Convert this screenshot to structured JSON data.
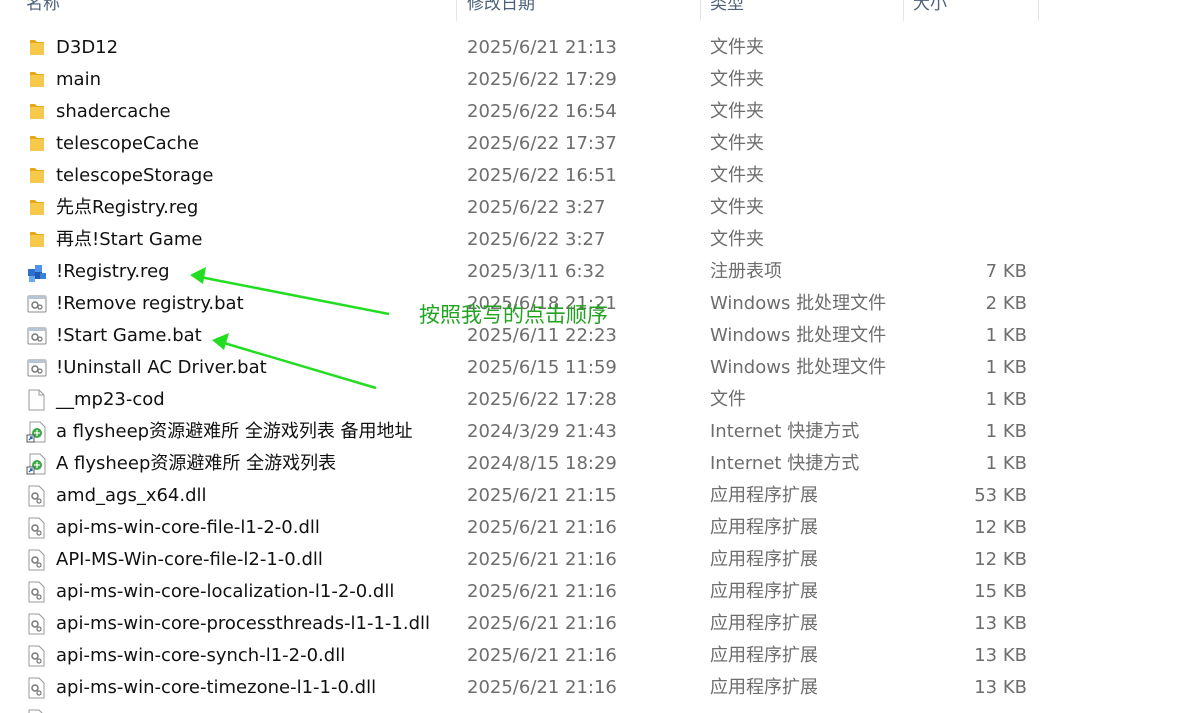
{
  "colors": {
    "annotation": "#22a322",
    "arrow": "#22dd22",
    "folder": "#f5c342",
    "header_text": "#4c607a",
    "secondary_text": "#6d6d6d"
  },
  "header": {
    "name": "名称",
    "date": "修改日期",
    "type": "类型",
    "size": "大小"
  },
  "files": [
    {
      "icon": "folder-icon",
      "name": "D3D12",
      "date": "2025/6/21 21:13",
      "type": "文件夹",
      "size": ""
    },
    {
      "icon": "folder-icon",
      "name": "main",
      "date": "2025/6/22 17:29",
      "type": "文件夹",
      "size": ""
    },
    {
      "icon": "folder-icon",
      "name": "shadercache",
      "date": "2025/6/22 16:54",
      "type": "文件夹",
      "size": ""
    },
    {
      "icon": "folder-icon",
      "name": "telescopeCache",
      "date": "2025/6/22 17:37",
      "type": "文件夹",
      "size": ""
    },
    {
      "icon": "folder-icon",
      "name": "telescopeStorage",
      "date": "2025/6/22 16:51",
      "type": "文件夹",
      "size": ""
    },
    {
      "icon": "folder-icon",
      "name": "先点Registry.reg",
      "date": "2025/6/22 3:27",
      "type": "文件夹",
      "size": ""
    },
    {
      "icon": "folder-icon",
      "name": "再点!Start Game",
      "date": "2025/6/22 3:27",
      "type": "文件夹",
      "size": ""
    },
    {
      "icon": "registry-file-icon",
      "name": "!Registry.reg",
      "date": "2025/3/11 6:32",
      "type": "注册表项",
      "size": "7 KB"
    },
    {
      "icon": "batch-file-icon",
      "name": "!Remove registry.bat",
      "date": "2025/6/18 21:21",
      "type": "Windows 批处理文件",
      "size": "2 KB"
    },
    {
      "icon": "batch-file-icon",
      "name": "!Start Game.bat",
      "date": "2025/6/11 22:23",
      "type": "Windows 批处理文件",
      "size": "1 KB"
    },
    {
      "icon": "batch-file-icon",
      "name": "!Uninstall AC Driver.bat",
      "date": "2025/6/15 11:59",
      "type": "Windows 批处理文件",
      "size": "1 KB"
    },
    {
      "icon": "blank-file-icon",
      "name": "__mp23-cod",
      "date": "2025/6/22 17:28",
      "type": "文件",
      "size": "1 KB"
    },
    {
      "icon": "internet-shortcut-icon",
      "name": "a flysheep资源避难所 全游戏列表 备用地址",
      "date": "2024/3/29 21:43",
      "type": "Internet 快捷方式",
      "size": "1 KB"
    },
    {
      "icon": "internet-shortcut-icon",
      "name": "A flysheep资源避难所 全游戏列表",
      "date": "2024/8/15 18:29",
      "type": "Internet 快捷方式",
      "size": "1 KB"
    },
    {
      "icon": "dll-file-icon",
      "name": "amd_ags_x64.dll",
      "date": "2025/6/21 21:15",
      "type": "应用程序扩展",
      "size": "53 KB"
    },
    {
      "icon": "dll-file-icon",
      "name": "api-ms-win-core-file-l1-2-0.dll",
      "date": "2025/6/21 21:16",
      "type": "应用程序扩展",
      "size": "12 KB"
    },
    {
      "icon": "dll-file-icon",
      "name": "API-MS-Win-core-file-l2-1-0.dll",
      "date": "2025/6/21 21:16",
      "type": "应用程序扩展",
      "size": "12 KB"
    },
    {
      "icon": "dll-file-icon",
      "name": "api-ms-win-core-localization-l1-2-0.dll",
      "date": "2025/6/21 21:16",
      "type": "应用程序扩展",
      "size": "15 KB"
    },
    {
      "icon": "dll-file-icon",
      "name": "api-ms-win-core-processthreads-l1-1-1.dll",
      "date": "2025/6/21 21:16",
      "type": "应用程序扩展",
      "size": "13 KB"
    },
    {
      "icon": "dll-file-icon",
      "name": "api-ms-win-core-synch-l1-2-0.dll",
      "date": "2025/6/21 21:16",
      "type": "应用程序扩展",
      "size": "13 KB"
    },
    {
      "icon": "dll-file-icon",
      "name": "api-ms-win-core-timezone-l1-1-0.dll",
      "date": "2025/6/21 21:16",
      "type": "应用程序扩展",
      "size": "13 KB"
    },
    {
      "icon": "dll-file-icon",
      "name": "",
      "date": "",
      "type": "",
      "size": ""
    }
  ],
  "annotation": {
    "text": "按照我写的点击顺序"
  }
}
